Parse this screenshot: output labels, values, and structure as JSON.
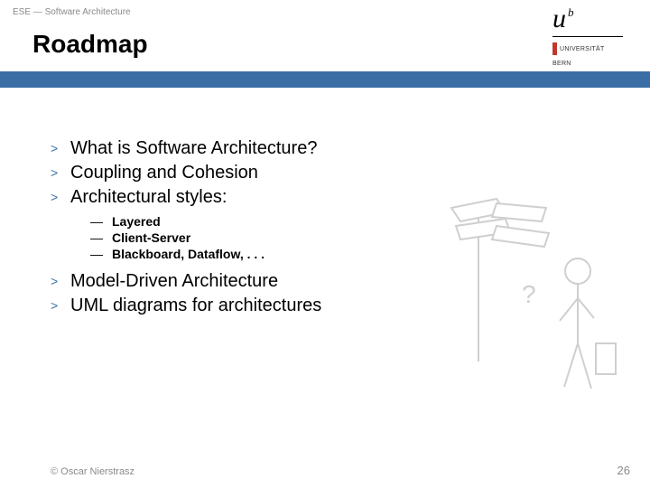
{
  "header": {
    "course_label": "ESE — Software Architecture"
  },
  "title": "Roadmap",
  "bullets": {
    "items": [
      {
        "text": "What is Software Architecture?"
      },
      {
        "text": "Coupling and Cohesion"
      },
      {
        "text": "Architectural styles:"
      }
    ],
    "sub": [
      {
        "text": "Layered"
      },
      {
        "text": "Client-Server"
      },
      {
        "text": "Blackboard, Dataflow, . . ."
      }
    ],
    "items2": [
      {
        "text": "Model-Driven Architecture"
      },
      {
        "text": "UML diagrams for architectures"
      }
    ]
  },
  "logo": {
    "u": "u",
    "b": "b",
    "line1": "UNIVERSITÄT",
    "line2": "BERN"
  },
  "footer": {
    "copyright": "© Oscar Nierstrasz",
    "page": "26"
  }
}
